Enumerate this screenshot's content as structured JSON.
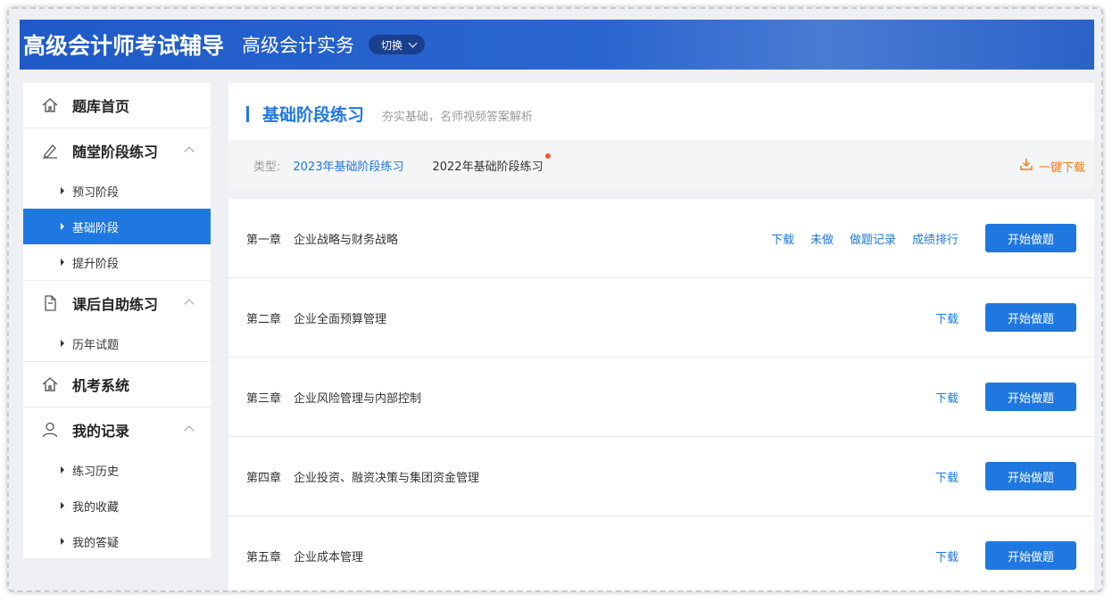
{
  "header": {
    "title": "高级会计师考试辅导",
    "subject": "高级会计实务",
    "switch_label": "切换"
  },
  "sidebar": {
    "groups": [
      {
        "label": "题库首页",
        "icon": "home-icon",
        "items": []
      },
      {
        "label": "随堂阶段练习",
        "icon": "pen-icon",
        "items": [
          "预习阶段",
          "基础阶段",
          "提升阶段"
        ]
      },
      {
        "label": "课后自助练习",
        "icon": "document-icon",
        "items": [
          "历年试题"
        ]
      },
      {
        "label": "机考系统",
        "icon": "home-icon",
        "items": []
      },
      {
        "label": "我的记录",
        "icon": "user-icon",
        "items": [
          "练习历史",
          "我的收藏",
          "我的答疑"
        ]
      }
    ],
    "active_item": "基础阶段"
  },
  "section": {
    "title": "基础阶段练习",
    "desc": "夯实基础，名师视频答案解析",
    "type_label": "类型:",
    "type_options": [
      "2023年基础阶段练习",
      "2022年基础阶段练习"
    ],
    "download_all": "一键下载"
  },
  "chapters": [
    {
      "num": "第一章",
      "name": "企业战略与财务战略",
      "actions": [
        "下载",
        "未做",
        "做题记录",
        "成绩排行"
      ],
      "start": "开始做题"
    },
    {
      "num": "第二章",
      "name": "企业全面预算管理",
      "actions": [
        "下载"
      ],
      "start": "开始做题"
    },
    {
      "num": "第三章",
      "name": "企业风险管理与内部控制",
      "actions": [
        "下载"
      ],
      "start": "开始做题"
    },
    {
      "num": "第四章",
      "name": "企业投资、融资决策与集团资金管理",
      "actions": [
        "下载"
      ],
      "start": "开始做题"
    },
    {
      "num": "第五章",
      "name": "企业成本管理",
      "actions": [
        "下载"
      ],
      "start": "开始做题"
    }
  ],
  "colors": {
    "accent": "#1f78e0",
    "header": "#2b66cf",
    "download": "#f07b16",
    "badge": "#f05a28"
  }
}
